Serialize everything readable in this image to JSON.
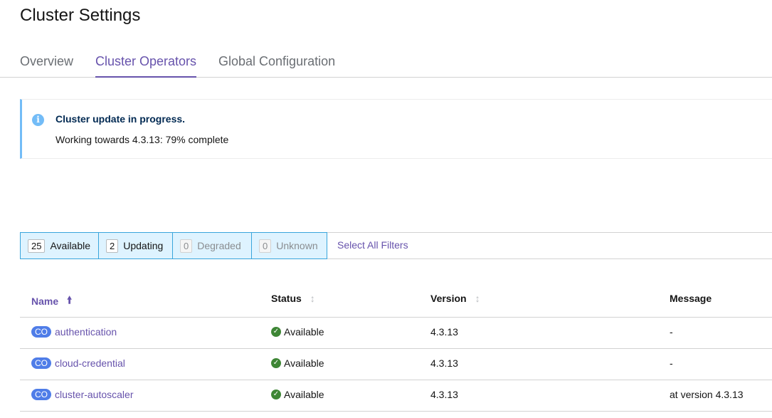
{
  "page": {
    "title": "Cluster Settings"
  },
  "tabs": [
    {
      "label": "Overview",
      "active": false
    },
    {
      "label": "Cluster Operators",
      "active": true
    },
    {
      "label": "Global Configuration",
      "active": false
    }
  ],
  "alert": {
    "icon": "info-icon",
    "title": "Cluster update in progress.",
    "body": "Working towards 4.3.13: 79% complete"
  },
  "filters": [
    {
      "count": "25",
      "label": "Available",
      "disabled": false
    },
    {
      "count": "2",
      "label": "Updating",
      "disabled": false
    },
    {
      "count": "0",
      "label": "Degraded",
      "disabled": true
    },
    {
      "count": "0",
      "label": "Unknown",
      "disabled": true
    }
  ],
  "select_all_label": "Select All Filters",
  "table": {
    "columns": {
      "name": "Name",
      "status": "Status",
      "version": "Version",
      "message": "Message"
    },
    "sort_column": "Name",
    "rows": [
      {
        "badge": "CO",
        "name": "authentication",
        "status": "Available",
        "version": "4.3.13",
        "message": "-"
      },
      {
        "badge": "CO",
        "name": "cloud-credential",
        "status": "Available",
        "version": "4.3.13",
        "message": "-"
      },
      {
        "badge": "CO",
        "name": "cluster-autoscaler",
        "status": "Available",
        "version": "4.3.13",
        "message": "at version 4.3.13"
      }
    ]
  },
  "colors": {
    "accent": "#6753ac",
    "info": "#73bcf7",
    "success": "#3e8635",
    "filter_bg": "#def3ff",
    "filter_border": "#39a5dc"
  }
}
